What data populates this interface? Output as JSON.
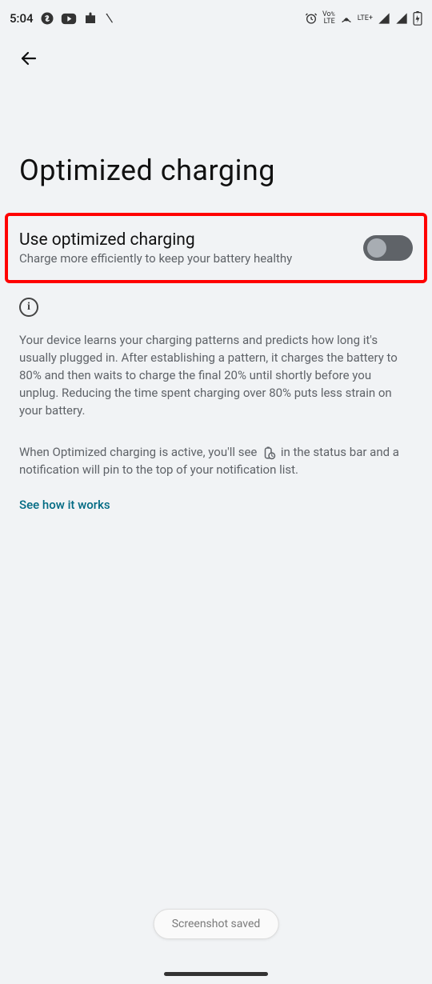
{
  "status_bar": {
    "time": "5:04",
    "network_label": "LTE+",
    "volte_label_top": "Vo",
    "volte_label_bot": "LTE"
  },
  "page": {
    "title": "Optimized charging"
  },
  "toggle_row": {
    "title": "Use optimized charging",
    "desc": "Charge more efficiently to keep your battery healthy",
    "enabled": false
  },
  "info": {
    "para_1": "Your device learns your charging patterns and predicts how long it's usually plugged in. After establishing a pattern, it charges the battery to 80% and then waits to charge the final 20% until shortly before you unplug. Reducing the time spent charging over 80% puts less strain on your battery.",
    "para_2a": "When Optimized charging is active, you'll see ",
    "para_2b": " in the status bar and a notification will pin to the top of your notification list."
  },
  "link": {
    "label": "See how it works"
  },
  "toast": {
    "label": "Screenshot saved"
  }
}
